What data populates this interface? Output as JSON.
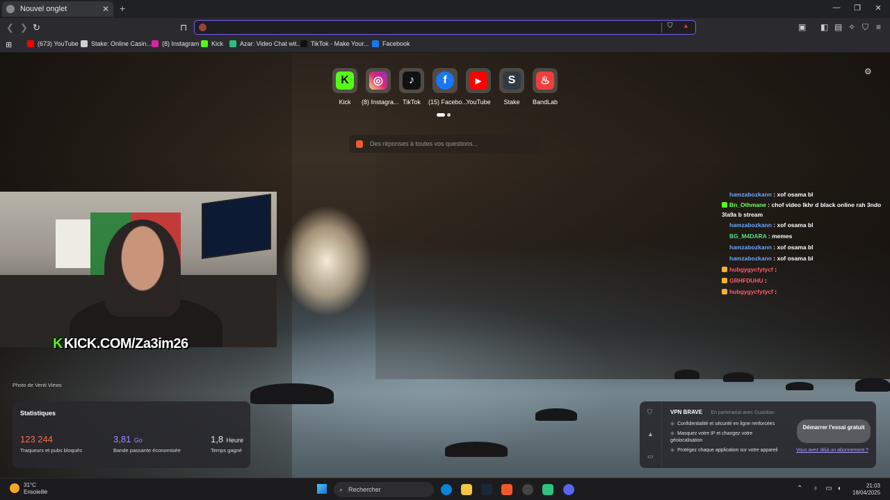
{
  "tab": {
    "title": "Nouvel onglet",
    "close": "✕",
    "new_tab": "+"
  },
  "window": {
    "minimize": "—",
    "maximize": "❐",
    "close": "✕"
  },
  "address_bar": {
    "value": "",
    "placeholder": ""
  },
  "bookmarks": [
    {
      "label": "(673) YouTube",
      "color": "#ff0000"
    },
    {
      "label": "Stake: Online Casin...",
      "color": "#cfcfd2"
    },
    {
      "label": "(8) Instagram",
      "color": "#d6249f"
    },
    {
      "label": "Kick",
      "color": "#53fc18"
    },
    {
      "label": "Azar: Video Chat wit...",
      "color": "#26c281"
    },
    {
      "label": "TikTok - Make Your...",
      "color": "#111111"
    },
    {
      "label": "Facebook",
      "color": "#1877f2"
    }
  ],
  "top_sites": [
    {
      "label": "Kick",
      "glyph": "K",
      "bg": "#53fc18",
      "fg": "#0b0b0b"
    },
    {
      "label": "(8) Instagra...",
      "glyph": "◎",
      "bg": "#d6249f",
      "fg": "#ffffff"
    },
    {
      "label": "TikTok",
      "glyph": "♪",
      "bg": "#111111",
      "fg": "#ffffff"
    },
    {
      "label": "(15) Facebo...",
      "glyph": "f",
      "bg": "#1877f2",
      "fg": "#ffffff"
    },
    {
      "label": "YouTube",
      "glyph": "▶",
      "bg": "#ff0000",
      "fg": "#ffffff"
    },
    {
      "label": "Stake",
      "glyph": "S",
      "bg": "#2f3b44",
      "fg": "#ffffff"
    },
    {
      "label": "BandLab",
      "glyph": "♨",
      "bg": "#f03e3e",
      "fg": "#ffffff"
    }
  ],
  "search": {
    "placeholder": "Des réponses à toutes vos questions..."
  },
  "stream": {
    "kick_tag": "KICK.COM/Za3im26",
    "kick_letter": "K"
  },
  "chat": [
    {
      "user": "hamzabozkann",
      "msg": "xof osama bl",
      "color": "#6aa8ff"
    },
    {
      "user": "Bn_Othmane",
      "msg": "chof video lkhr d black online rah 3ndo 3la9a b stream",
      "color": "#7cff5a"
    },
    {
      "user": "hamzabozkann",
      "msg": "xof osama bl",
      "color": "#6aa8ff"
    },
    {
      "user": "BG_M4DARA",
      "msg": "memes",
      "color": "#55e08a"
    },
    {
      "user": "hamzabozkann",
      "msg": "xof osama bl",
      "color": "#6aa8ff"
    },
    {
      "user": "hamzabozkann",
      "msg": "xof osama bl",
      "color": "#6aa8ff"
    },
    {
      "user": "hubgygycfytycf",
      "msg": "",
      "color": "#ff5b6e"
    },
    {
      "user": "GRHFDUHU",
      "msg": "",
      "color": "#ff5b6e"
    },
    {
      "user": "hubgygycfytycf",
      "msg": "",
      "color": "#ff5b6e"
    }
  ],
  "photo_credit": "Photo de Venti Views",
  "stats": {
    "title": "Statistiques",
    "trackers": {
      "value": "123 244",
      "unit": "",
      "desc": "Traqueurs et pubs bloqués",
      "color": "#ff6a4d"
    },
    "bandwidth": {
      "value": "3,81",
      "unit": "Go",
      "desc": "Bande passante économisée",
      "color": "#a48cff"
    },
    "time": {
      "value": "1,8",
      "unit": "Heure",
      "desc": "Temps gagné",
      "color": "#ffffff"
    }
  },
  "vpn": {
    "title": "VPN BRAVE",
    "partner": "En partenariat avec Guardian",
    "features": [
      "Confidentialité et sécurité en ligne renforcées",
      "Masquez votre IP et changez votre géolocalisation",
      "Protégez chaque application sur votre appareil"
    ],
    "cta": "Démarrer l'essai gratuit",
    "link": "Vous avez déjà un abonnement ?"
  },
  "taskbar": {
    "temperature": "31°C",
    "weather": "Ensoleillé",
    "search_label": "Rechercher",
    "time": "21:03",
    "date": "18/04/2025"
  }
}
